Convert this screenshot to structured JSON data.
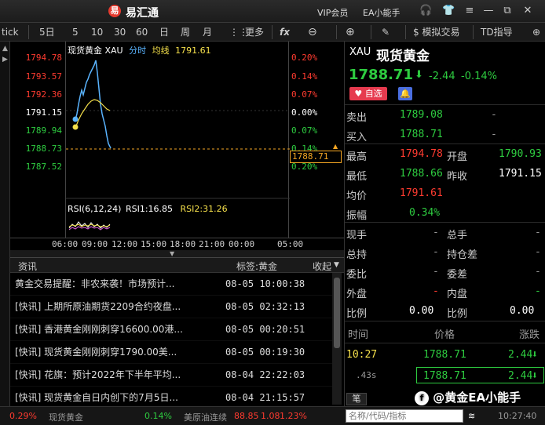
{
  "titlebar": {
    "logo": "易",
    "app_name": "易汇通",
    "vip": "VIP会员",
    "ea": "EA小能手"
  },
  "toolbar": {
    "tick": "tick",
    "periods": [
      "5日",
      "5",
      "10",
      "30",
      "60",
      "日",
      "周",
      "月"
    ],
    "more": "更多",
    "fx": "fx",
    "mock_trade": "$ 模拟交易",
    "td_guide": "TD指导"
  },
  "chart": {
    "legend_name": "现货黄金 XAU",
    "legend_mode": "分时",
    "legend_avg_label": "均线",
    "legend_avg_value": "1791.61",
    "y_prices": [
      "1794.78",
      "1793.57",
      "1792.36",
      "1791.15",
      "1789.94",
      "1788.73",
      "1787.52"
    ],
    "y_pcts": [
      "0.20%",
      "0.14%",
      "0.07%",
      "0.00%",
      "0.07%",
      "0.14%",
      "0.20%"
    ],
    "current_price_tag": "1788.71",
    "rsi_label": "RSI(6,12,24)",
    "rsi1": "RSI1:16.85",
    "rsi2": "RSI2:31.26",
    "times": [
      "06:00",
      "09:00",
      "12:00",
      "15:00",
      "18:00",
      "21:00",
      "00:00",
      "05:00"
    ]
  },
  "news": {
    "tab": "资讯",
    "tag": "标签:黄金",
    "collapse": "收起",
    "items": [
      {
        "title": "黄金交易提醒：非农来袭！市场预计...",
        "time": "08-05 10:00:38"
      },
      {
        "title": "[快讯] 上期所原油期货2209合约夜盘...",
        "time": "08-05 02:32:13"
      },
      {
        "title": "[快讯] 香港黄金刚刚刺穿16600.00港...",
        "time": "08-05 00:20:51"
      },
      {
        "title": "[快讯] 现货黄金刚刚刺穿1790.00美...",
        "time": "08-05 00:19:30"
      },
      {
        "title": "[快讯] 花旗：预计2022年下半年平均...",
        "time": "08-04 22:22:03"
      },
      {
        "title": "[快讯] 现货黄金自日内创下的7月5日...",
        "time": "08-04 21:15:57"
      }
    ]
  },
  "quote": {
    "code": "XAU",
    "name": "现货黄金",
    "price": "1788.71",
    "change": "-2.44",
    "change_pct": "-0.14%",
    "watch_btn": "自选",
    "sell_label": "卖出",
    "sell": "1789.08",
    "sell_vol": "-",
    "buy_label": "买入",
    "buy": "1788.71",
    "buy_vol": "-",
    "high_label": "最高",
    "high": "1794.78",
    "open_label": "开盘",
    "open": "1790.93",
    "low_label": "最低",
    "low": "1788.66",
    "prev_label": "昨收",
    "prev": "1791.15",
    "avg_label": "均价",
    "avg": "1791.61",
    "amp_label": "振幅",
    "amp": "0.34%",
    "rows2": [
      {
        "l1": "现手",
        "v1": "-",
        "l2": "总手",
        "v2": "-"
      },
      {
        "l1": "总持",
        "v1": "-",
        "l2": "持仓差",
        "v2": "-"
      },
      {
        "l1": "委比",
        "v1": "-",
        "l2": "委差",
        "v2": "-"
      },
      {
        "l1": "外盘",
        "v1": "-",
        "l2": "内盘",
        "v2": "-"
      },
      {
        "l1": "比例",
        "v1": "0.00",
        "l2": "比例",
        "v2": "0.00"
      }
    ],
    "tick_head": {
      "time": "时间",
      "price": "价格",
      "change": "涨跌"
    },
    "ticks": [
      {
        "time": "10:27",
        "price": "1788.71",
        "change": "2.44"
      },
      {
        "time": ".43s",
        "price": "1788.71",
        "change": "2.44"
      }
    ],
    "search_placeholder": "名称/代码/指标"
  },
  "statusbar": {
    "pct1": "0.29%",
    "name1": "现货黄金",
    "pct2": "0.14%",
    "name2": "美原油连续",
    "val2": "88.85",
    "chg2": "1.08",
    "pct3": "1.23%",
    "clock": "10:27:40"
  },
  "watermark": "@黄金EA小能手",
  "colors": {
    "up": "#ff3b30",
    "down": "#2ecc40",
    "price_line": "#5ab4ff",
    "avg_line": "#f5e04b"
  }
}
